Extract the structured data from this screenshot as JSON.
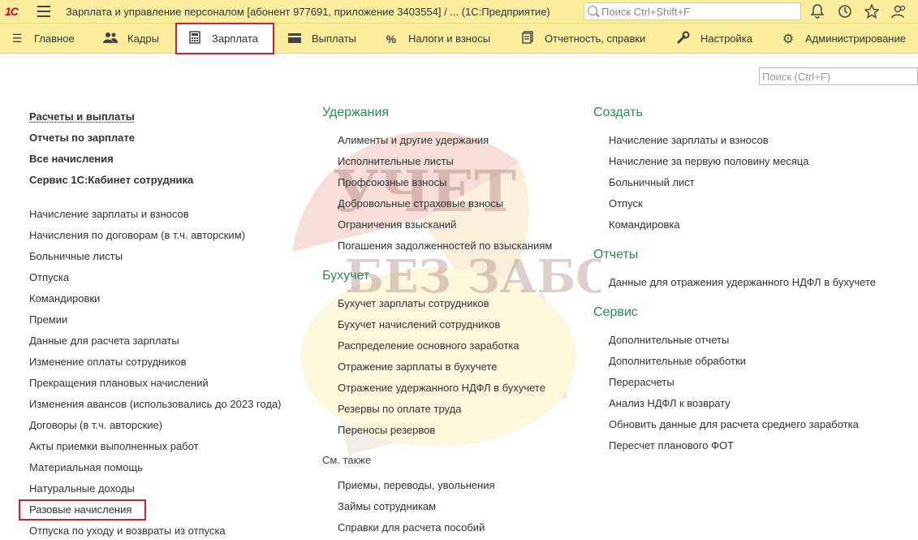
{
  "window": {
    "logo": "1С",
    "title": "Зарплата и управление персоналом [абонент 977691, приложение 3403554] / ...   (1С:Предприятие)",
    "search_placeholder": "Поиск Ctrl+Shift+F"
  },
  "sections": [
    {
      "label": "Главное",
      "icon": "menu-icon"
    },
    {
      "label": "Кадры",
      "icon": "people-icon"
    },
    {
      "label": "Зарплата",
      "icon": "calculator-icon",
      "active": true
    },
    {
      "label": "Выплаты",
      "icon": "wallet-icon"
    },
    {
      "label": "Налоги и взносы",
      "icon": "percent-icon"
    },
    {
      "label": "Отчетность, справки",
      "icon": "documents-icon"
    },
    {
      "label": "Настройка",
      "icon": "wrench-icon"
    },
    {
      "label": "Администрирование",
      "icon": "gear-icon"
    }
  ],
  "page_search_placeholder": "Поиск (Ctrl+F)",
  "left": {
    "bold": [
      "Расчеты и выплаты",
      "Отчеты по зарплате",
      "Все начисления",
      "Сервис 1С:Кабинет сотрудника"
    ],
    "items": [
      "Начисление зарплаты и взносов",
      "Начисления по договорам (в т.ч. авторским)",
      "Больничные листы",
      "Отпуска",
      "Командировки",
      "Премии",
      "Данные для расчета зарплаты",
      "Изменение оплаты сотрудников",
      "Прекращения плановых начислений",
      "Изменения авансов (использовались до 2023 года)",
      "Договоры (в т.ч. авторские)",
      "Акты приемки выполненных работ",
      "Материальная помощь",
      "Натуральные доходы",
      "Разовые начисления",
      "Отпуска по уходу и возвраты из отпуска"
    ]
  },
  "middle": {
    "withholdings": {
      "title": "Удержания",
      "items": [
        "Алименты и другие удержания",
        "Исполнительные листы",
        "Профсоюзные взносы",
        "Добровольные страховые взносы",
        "Ограничения взысканий",
        "Погашения задолженностей по взысканиям"
      ]
    },
    "accounting": {
      "title": "Бухучет",
      "items": [
        "Бухучет зарплаты сотрудников",
        "Бухучет начислений сотрудников",
        "Распределение основного заработка",
        "Отражение зарплаты в бухучете",
        "Отражение удержанного НДФЛ в бухучете",
        "Резервы по оплате труда",
        "Переносы резервов"
      ]
    },
    "see_also": {
      "title": "См. также",
      "items": [
        "Приемы, переводы, увольнения",
        "Займы сотрудникам",
        "Справки для расчета пособий"
      ]
    }
  },
  "right": {
    "create": {
      "title": "Создать",
      "items": [
        "Начисление зарплаты и взносов",
        "Начисление за первую половину месяца",
        "Больничный лист",
        "Отпуск",
        "Командировка"
      ]
    },
    "reports": {
      "title": "Отчеты",
      "items": [
        "Данные для отражения удержанного НДФЛ в бухучете"
      ]
    },
    "service": {
      "title": "Сервис",
      "items": [
        "Дополнительные отчеты",
        "Дополнительные обработки",
        "Перерасчеты",
        "Анализ НДФЛ к возврату",
        "Обновить данные для расчета среднего заработка",
        "Пересчет планового ФОТ"
      ]
    }
  },
  "watermark": {
    "line1": "УЧЕТ",
    "line2": "БЕЗ ЗАБОТ"
  },
  "colors": {
    "panel": "#fbed9e",
    "group_title": "#2e8b4f",
    "highlight": "#d0202e"
  }
}
